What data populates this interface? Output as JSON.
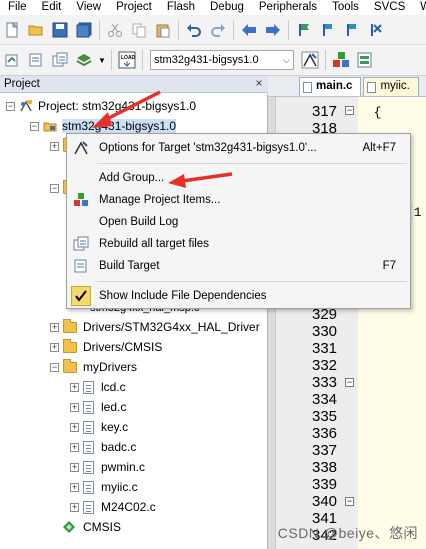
{
  "menubar": [
    "File",
    "Edit",
    "View",
    "Project",
    "Flash",
    "Debug",
    "Peripherals",
    "Tools",
    "SVCS",
    "W"
  ],
  "toolbar2": {
    "target": "stm32g431-bigsys1.0"
  },
  "project_panel": {
    "title": "Project",
    "root": "Project: stm32g431-bigsys1.0",
    "target": "stm32g431-bigsys1.0",
    "hidden_item": "stm32g4xx_hal_msp.c",
    "groups": [
      {
        "label": "Drivers/STM32G4xx_HAL_Driver",
        "expanded": false
      },
      {
        "label": "Drivers/CMSIS",
        "expanded": false
      },
      {
        "label": "myDrivers",
        "expanded": true
      }
    ],
    "my_drivers_files": [
      "lcd.c",
      "led.c",
      "key.c",
      "badc.c",
      "pwmin.c",
      "myiic.c",
      "M24C02.c"
    ],
    "cmsis": "CMSIS"
  },
  "editor": {
    "tabs": [
      {
        "label": "main.c",
        "active": true
      },
      {
        "label": "myiic.",
        "active": false
      }
    ],
    "line_numbers_top": [
      "317",
      "318"
    ],
    "line_numbers_bottom": [
      "329",
      "330",
      "331",
      "332",
      "333",
      "334",
      "335",
      "336",
      "337",
      "338",
      "339",
      "340",
      "341",
      "342"
    ],
    "code_fragments": {
      "l317": "  {",
      "l318": "",
      "brace_mid": "(1"
    }
  },
  "context_menu": {
    "items": [
      {
        "icon": "options-icon",
        "label": "Options for Target 'stm32g431-bigsys1.0'...",
        "shortcut": "Alt+F7"
      },
      {
        "icon": "",
        "label": "Add Group...",
        "shortcut": ""
      },
      {
        "icon": "manage-items-icon",
        "label": "Manage Project Items...",
        "shortcut": ""
      },
      {
        "icon": "",
        "label": "Open Build Log",
        "shortcut": ""
      },
      {
        "icon": "rebuild-icon",
        "label": "Rebuild all target files",
        "shortcut": ""
      },
      {
        "icon": "build-icon",
        "label": "Build Target",
        "shortcut": "F7"
      },
      {
        "icon": "checkmark-icon",
        "label": "Show Include File Dependencies",
        "shortcut": "",
        "checked": true
      }
    ]
  },
  "watermark": "CSDN @beiye、悠闲",
  "colors": {
    "arrow": "#e8302a",
    "selection": "#cce0f5",
    "menu_bg": "#f5f5f5",
    "editor_bg": "#fffde8"
  }
}
